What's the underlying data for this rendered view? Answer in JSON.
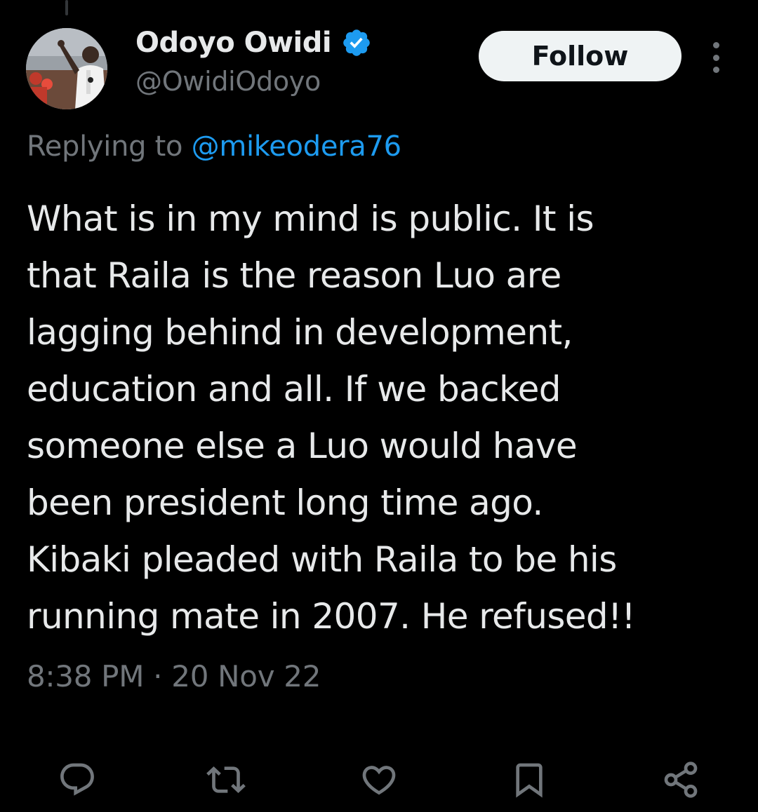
{
  "tweet": {
    "author": {
      "display_name": "Odoyo Owidi",
      "handle": "@OwidiOdoyo",
      "verified": true
    },
    "follow_label": "Follow",
    "reply_context": {
      "prefix": "Replying to ",
      "mention": "@mikeodera76"
    },
    "text_lines": [
      "What is in my mind is public. It is",
      "that Raila is the reason Luo are",
      "lagging behind in development,",
      "education and all. If we backed",
      "someone else a Luo would have",
      "been president long time ago.",
      "Kibaki pleaded with Raila to be his",
      "running mate in 2007. He refused!!"
    ],
    "timestamp": "8:38 PM · 20 Nov 22"
  },
  "actions": [
    {
      "icon": "reply-icon"
    },
    {
      "icon": "retweet-icon"
    },
    {
      "icon": "like-icon"
    },
    {
      "icon": "bookmark-icon"
    },
    {
      "icon": "share-icon"
    }
  ],
  "colors": {
    "background": "#000000",
    "text_primary": "#e7e9ea",
    "text_secondary": "#71767b",
    "accent": "#1d9bf0",
    "verified_badge": "#1d9bf0",
    "follow_button_bg": "#eff3f4"
  }
}
